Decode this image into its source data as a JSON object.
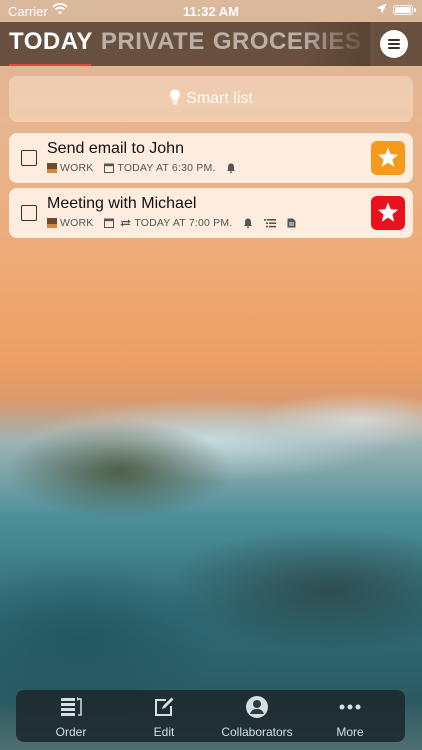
{
  "status_bar": {
    "carrier": "Carrier",
    "time": "11:32 AM"
  },
  "header": {
    "tabs": [
      {
        "label": "TODAY",
        "active": true
      },
      {
        "label": "PRIVATE",
        "active": false
      },
      {
        "label": "GROCERIES",
        "active": false
      }
    ],
    "menu_icon": "hamburger-icon"
  },
  "smart_list": {
    "label": "Smart list",
    "icon": "lightbulb-icon"
  },
  "tasks": [
    {
      "title": "Send email to John",
      "list": "WORK",
      "due": "TODAY AT 6:30 PM.",
      "icons": [
        "calendar-icon",
        "bell-icon"
      ],
      "star_color": "#f59a1b"
    },
    {
      "title": "Meeting with Michael",
      "list": "WORK",
      "due": "TODAY AT 7:00 PM.",
      "icons": [
        "calendar-icon",
        "repeat-icon",
        "bell-icon",
        "subtasks-icon",
        "note-icon"
      ],
      "star_color": "#e8121f"
    }
  ],
  "toolbar": {
    "items": [
      {
        "label": "Order",
        "icon": "order-icon"
      },
      {
        "label": "Edit",
        "icon": "edit-icon"
      },
      {
        "label": "Collaborators",
        "icon": "collaborators-icon"
      },
      {
        "label": "More",
        "icon": "more-icon"
      }
    ]
  },
  "colors": {
    "header_bg": "#584232",
    "accent_underline": "#e04a3a",
    "card_bg": "#fff0e4"
  }
}
